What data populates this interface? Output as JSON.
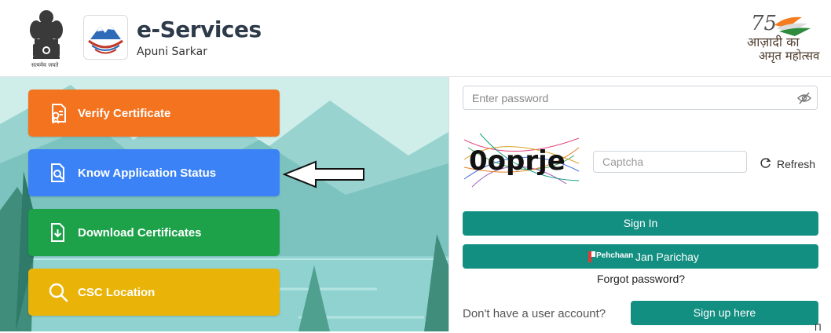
{
  "header": {
    "emblem_caption": "सत्यमेव जयते",
    "title": "e-Services",
    "subtitle": "Apuni Sarkar",
    "azadi_line1": "आज़ादी का",
    "azadi_line2": "अमृत महोत्सव",
    "azadi_number": "75"
  },
  "tiles": [
    {
      "label": "Verify Certificate",
      "icon": "certificate-icon",
      "color": "#f4731f"
    },
    {
      "label": "Know Application Status",
      "icon": "document-search-icon",
      "color": "#3b82f6"
    },
    {
      "label": "Download Certificates",
      "icon": "download-file-icon",
      "color": "#1da24a"
    },
    {
      "label": "CSC Location",
      "icon": "search-icon",
      "color": "#eab308"
    }
  ],
  "login": {
    "password_placeholder": "Enter password",
    "captcha_text": "0oprje",
    "captcha_placeholder": "Captcha",
    "refresh_label": "Refresh",
    "signin_label": "Sign In",
    "janparichay_brand": "Pehchaan",
    "janparichay_label": "Jan Parichay",
    "forgot_label": "Forgot password?",
    "noaccount_text": "Don't have a user account?",
    "signup_label": "Sign up here"
  },
  "colors": {
    "teal": "#138f82",
    "header_text": "#2d3a4a"
  },
  "corner_text": "Π"
}
